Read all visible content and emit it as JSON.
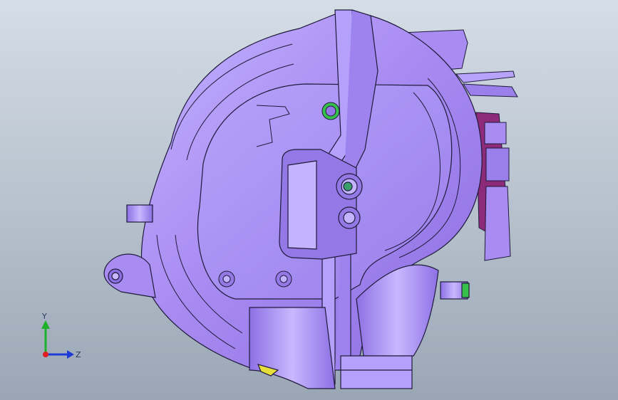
{
  "viewport": {
    "background_top": "#d5dde6",
    "background_bottom": "#9aa6b4",
    "part_color": "#a98cf2",
    "part_shadow": "#7c5fd6",
    "part_highlight": "#d6c9ff",
    "edge_color": "#1e1a3a",
    "accent_green": "#36c24a",
    "accent_yellow": "#e6de3a",
    "accent_magenta": "#8e2a7a"
  },
  "triad": {
    "y_label": "Y",
    "z_label": "Z",
    "x_color": "#e02020",
    "y_color": "#1fb02a",
    "z_color": "#1f3bd6"
  }
}
